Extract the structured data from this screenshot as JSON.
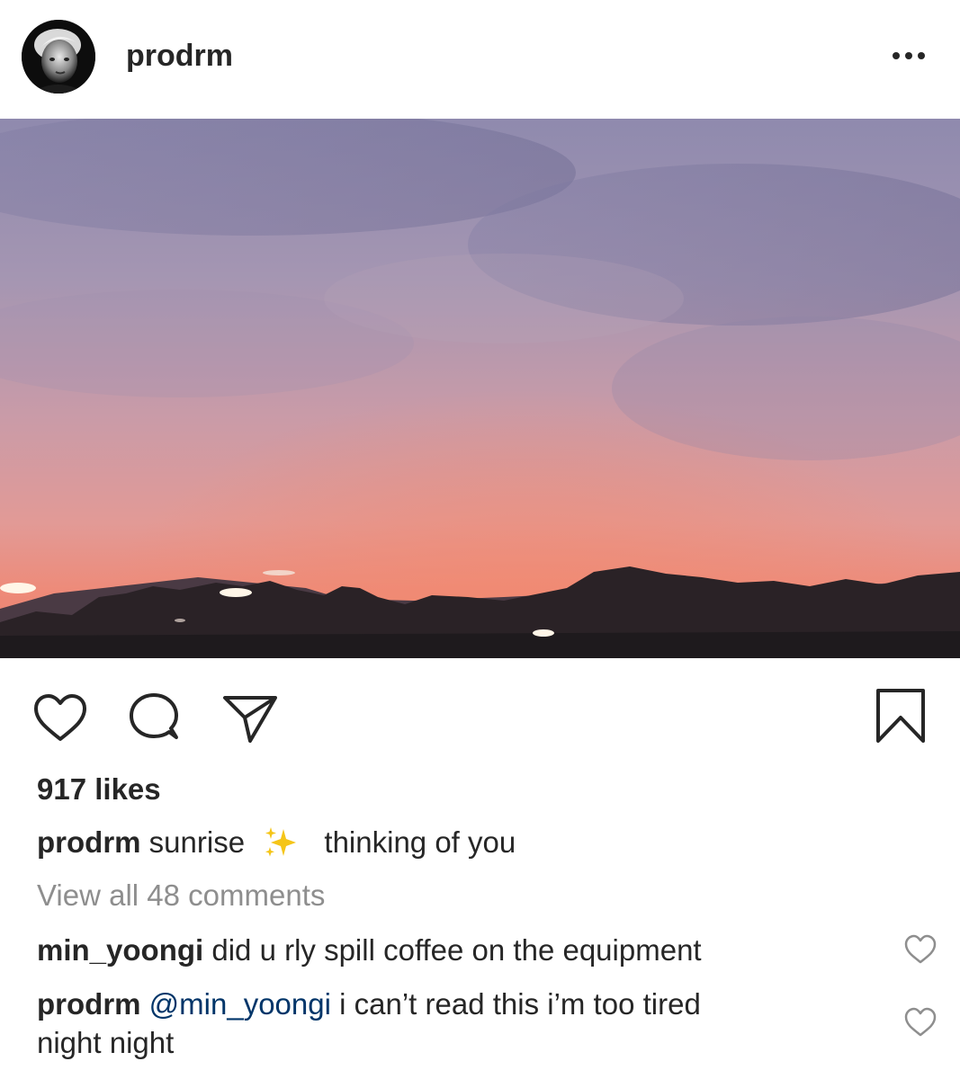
{
  "post": {
    "username": "prodrm",
    "likes": "917 likes",
    "caption": {
      "username": "prodrm",
      "text_before": "sunrise",
      "emoji": "sparkles",
      "text_after": "thinking of you"
    },
    "view_comments": "View all 48 comments",
    "comments": [
      {
        "username": "min_yoongi",
        "text": "did u rly spill coffee on the equipment"
      },
      {
        "username": "prodrm",
        "mention": "@min_yoongi",
        "text_line1": "i can’t read this i’m too tired",
        "text_line2": "night night"
      }
    ]
  },
  "icons": {
    "more": "more-options-icon",
    "like": "heart-icon",
    "comment": "comment-bubble-icon",
    "share": "paper-plane-icon",
    "save": "bookmark-icon"
  },
  "colors": {
    "text": "#262626",
    "secondary_text": "#8e8e8e",
    "mention": "#003569"
  }
}
